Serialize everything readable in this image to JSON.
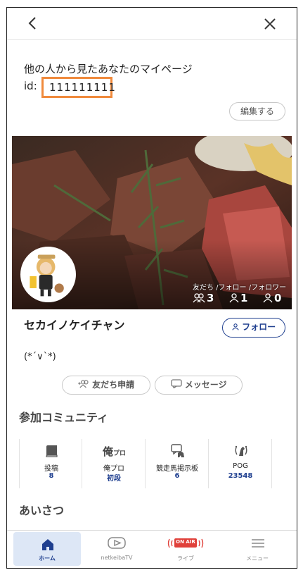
{
  "header": {
    "back_icon": "chevron-left-icon",
    "close_icon": "close-icon"
  },
  "intro": {
    "title": "他の人から見たあなたのマイページ",
    "id_label": "id:",
    "id_value": "111111111"
  },
  "edit_button": "編集する",
  "stats": {
    "label": "友だち /フォロー /フォロワー",
    "friends": "3",
    "following": "1",
    "followers": "0"
  },
  "profile": {
    "name": "セカイノケイチャン",
    "follow_button": "フォロー",
    "bio": "(*´∨`*)"
  },
  "actions": {
    "friend_request": "友だち申請",
    "message": "メッセージ"
  },
  "community": {
    "title": "参加コミュニティ",
    "items": [
      {
        "label": "投稿",
        "value": "8",
        "icon": "book-icon"
      },
      {
        "label": "俺プロ",
        "value": "初段",
        "icon": "ore-pro-icon"
      },
      {
        "label": "競走馬掲示板",
        "value": "6",
        "icon": "board-icon"
      },
      {
        "label": "POG",
        "value": "23548",
        "icon": "horse-icon"
      }
    ]
  },
  "greeting": {
    "title": "あいさつ"
  },
  "tabbar": {
    "items": [
      {
        "label": "ホーム",
        "icon": "home-icon"
      },
      {
        "label": "netkeibaTV",
        "icon": "play-icon"
      },
      {
        "label": "ライブ",
        "icon": "on-air-icon",
        "badge": "ON AIR"
      },
      {
        "label": "メニュー",
        "icon": "menu-icon"
      }
    ]
  },
  "colors": {
    "accent": "#1f3f8f",
    "highlight": "#f08a3c",
    "active_tab_bg": "#dde7f6",
    "onair": "#e0403a"
  }
}
